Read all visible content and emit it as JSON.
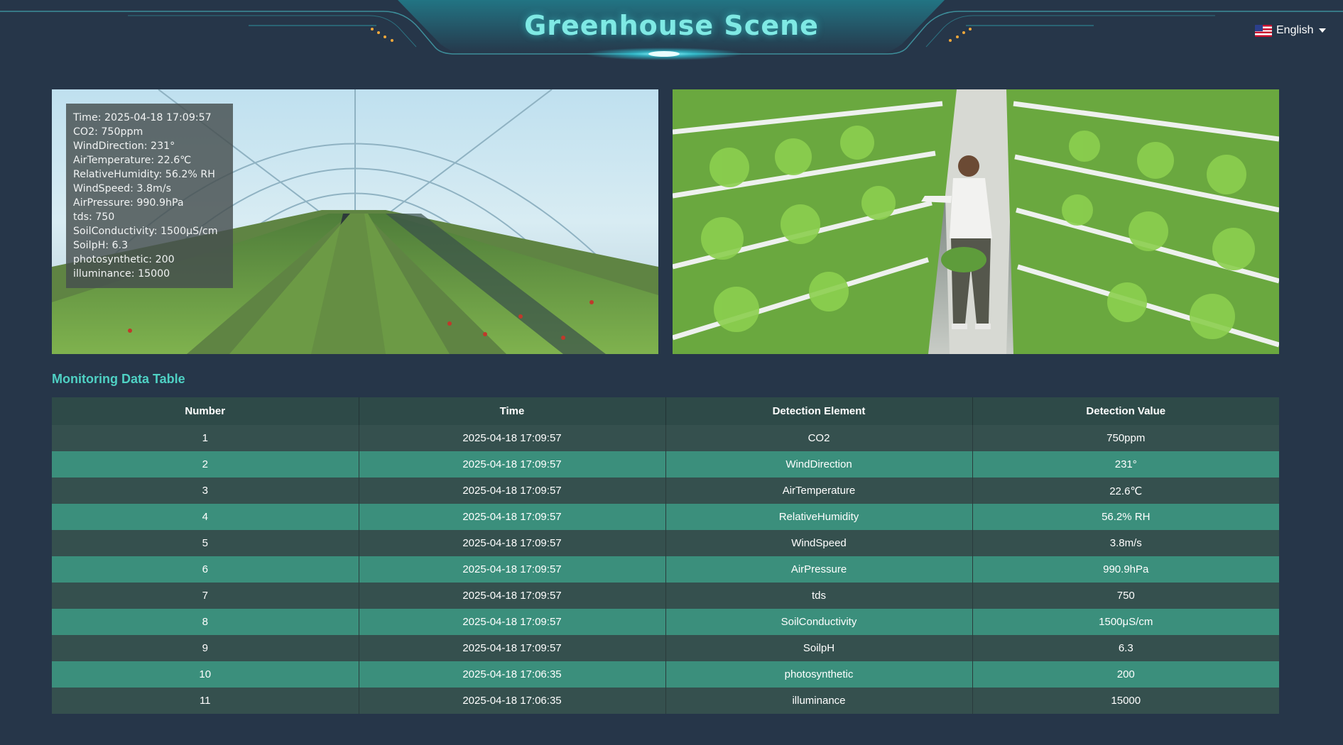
{
  "header": {
    "title": "Greenhouse Scene",
    "language": {
      "label": "English",
      "icon": "us-flag-icon"
    }
  },
  "scenes": {
    "left": {
      "overlay": [
        "Time:  2025-04-18 17:09:57",
        "CO2: 750ppm",
        "WindDirection: 231°",
        "AirTemperature: 22.6℃",
        "RelativeHumidity: 56.2% RH",
        "WindSpeed: 3.8m/s",
        "AirPressure: 990.9hPa",
        "tds: 750",
        "SoilConductivity: 1500μS/cm",
        "SoilpH: 6.3",
        "photosynthetic: 200",
        "illuminance: 15000"
      ]
    }
  },
  "table": {
    "title": "Monitoring Data Table",
    "columns": [
      "Number",
      "Time",
      "Detection Element",
      "Detection Value"
    ],
    "rows": [
      [
        "1",
        "2025-04-18 17:09:57",
        "CO2",
        "750ppm"
      ],
      [
        "2",
        "2025-04-18 17:09:57",
        "WindDirection",
        "231°"
      ],
      [
        "3",
        "2025-04-18 17:09:57",
        "AirTemperature",
        "22.6℃"
      ],
      [
        "4",
        "2025-04-18 17:09:57",
        "RelativeHumidity",
        "56.2% RH"
      ],
      [
        "5",
        "2025-04-18 17:09:57",
        "WindSpeed",
        "3.8m/s"
      ],
      [
        "6",
        "2025-04-18 17:09:57",
        "AirPressure",
        "990.9hPa"
      ],
      [
        "7",
        "2025-04-18 17:09:57",
        "tds",
        "750"
      ],
      [
        "8",
        "2025-04-18 17:09:57",
        "SoilConductivity",
        "1500μS/cm"
      ],
      [
        "9",
        "2025-04-18 17:09:57",
        "SoilpH",
        "6.3"
      ],
      [
        "10",
        "2025-04-18 17:06:35",
        "photosynthetic",
        "200"
      ],
      [
        "11",
        "2025-04-18 17:06:35",
        "illuminance",
        "15000"
      ]
    ]
  },
  "colors": {
    "background": "#263649",
    "accent": "#4fd1c4",
    "row_odd": "#35504e",
    "row_even": "#3b8f7c"
  }
}
